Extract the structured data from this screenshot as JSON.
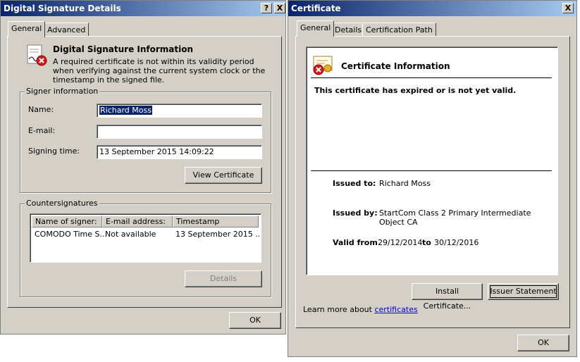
{
  "sig_window": {
    "title": "Digital Signature Details",
    "help_btn": "?",
    "close_btn": "X",
    "tabs": [
      {
        "label": "General"
      },
      {
        "label": "Advanced"
      }
    ],
    "info_heading": "Digital Signature Information",
    "info_text": "A required certificate is not within its validity period when verifying against the current system clock or the timestamp in the signed file.",
    "signer_group": "Signer information",
    "name_label": "Name:",
    "name_value": "Richard Moss",
    "email_label": "E-mail:",
    "email_value": "",
    "signing_time_label": "Signing time:",
    "signing_time_value": "13 September 2015 14:09:22",
    "view_cert_btn": "View Certificate",
    "counter_group": "Countersignatures",
    "columns": [
      "Name of signer:",
      "E-mail address:",
      "Timestamp"
    ],
    "rows": [
      {
        "name": "COMODO Time S...",
        "email": "Not available",
        "timestamp": "13 September 2015 ..."
      }
    ],
    "details_btn": "Details",
    "ok_btn": "OK"
  },
  "cert_window": {
    "title": "Certificate",
    "close_btn": "X",
    "tabs": [
      {
        "label": "General"
      },
      {
        "label": "Details"
      },
      {
        "label": "Certification Path"
      }
    ],
    "info_heading": "Certificate Information",
    "status_text": "This certificate has expired or is not yet valid.",
    "issued_to_label": "Issued to:",
    "issued_to_value": "Richard Moss",
    "issued_by_label": "Issued by:",
    "issued_by_value": "StartCom Class 2 Primary Intermediate Object CA",
    "valid_from_label": "Valid from",
    "valid_from_value": "29/12/2014",
    "to_label": "to",
    "valid_to_value": "30/12/2016",
    "install_btn": "Install Certificate...",
    "issuer_btn": "Issuer Statement",
    "learn_text": "Learn more about",
    "learn_link": "certificates",
    "ok_btn": "OK"
  }
}
